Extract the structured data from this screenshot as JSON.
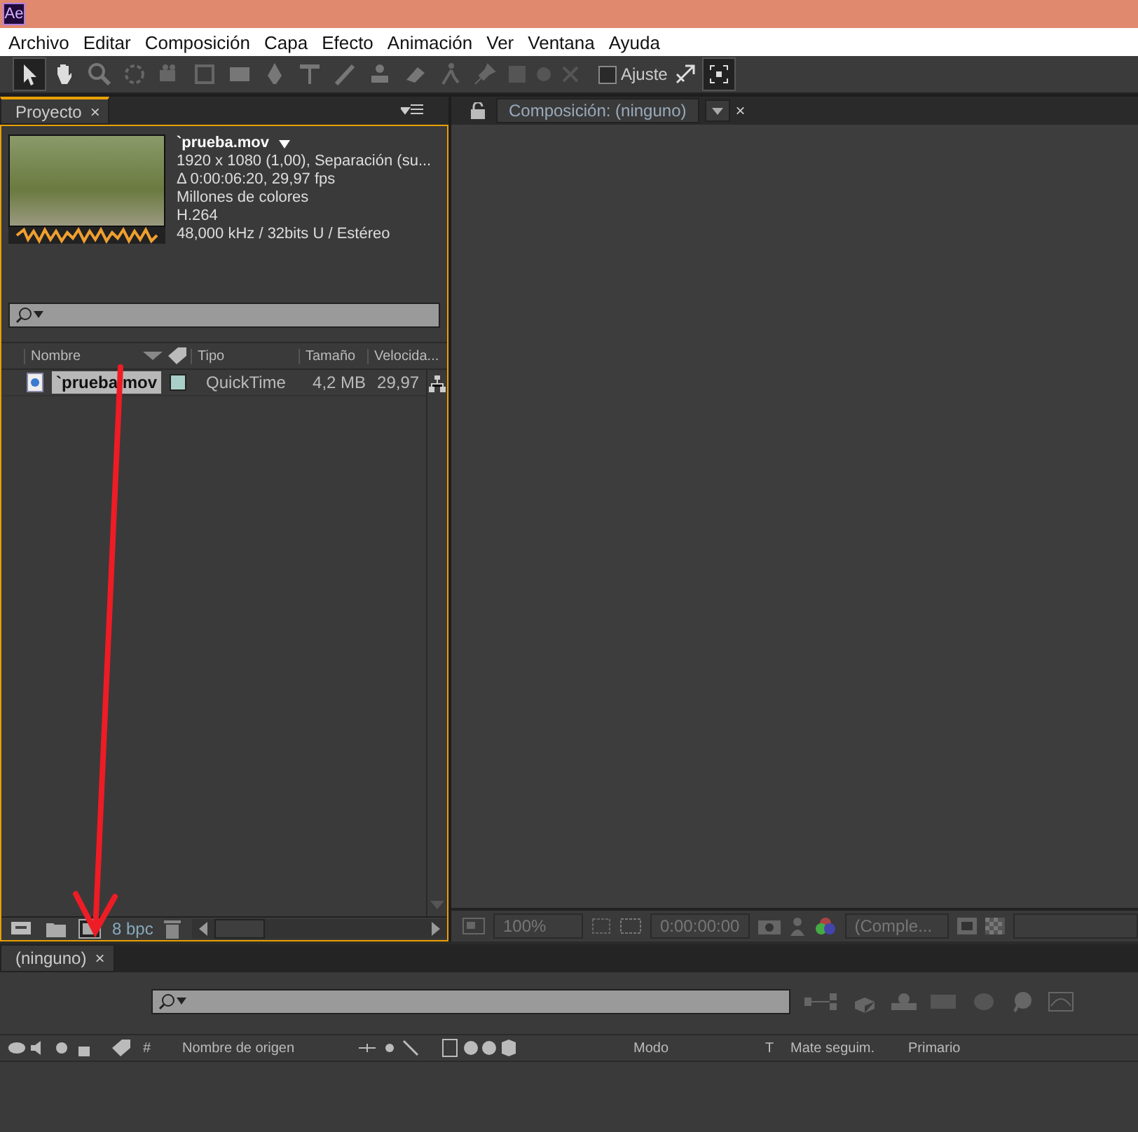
{
  "app_icon": "Ae",
  "menu": [
    "Archivo",
    "Editar",
    "Composición",
    "Capa",
    "Efecto",
    "Animación",
    "Ver",
    "Ventana",
    "Ayuda"
  ],
  "toolbar": {
    "snap": {
      "label": "Ajuste",
      "checked": false
    }
  },
  "project_panel": {
    "tab": "Proyecto",
    "close": "×",
    "preview": {
      "name": "`prueba.mov",
      "details": [
        "1920 x 1080 (1,00), Separación (su...",
        "Δ 0:00:06:20, 29,97 fps",
        "Millones de colores",
        "H.264",
        "48,000 kHz / 32bits U / Estéreo"
      ]
    },
    "columns": [
      "Nombre",
      "Tipo",
      "Tamaño",
      "Velocida..."
    ],
    "rows": [
      {
        "name": "`prueba.mov",
        "type": "QuickTime",
        "size": "4,2 MB",
        "speed": "29,97",
        "selected": true,
        "color": "#a8d0c8"
      }
    ],
    "bpc": "8 bpc"
  },
  "composition_panel": {
    "tab": "Composición: (ninguno)",
    "close": "×",
    "zoom": "100%",
    "timecode": "0:00:00:00",
    "resolution": "(Comple..."
  },
  "timeline": {
    "tab": "(ninguno)",
    "close": "×",
    "columns": [
      "#",
      "Nombre de origen",
      "Modo",
      "T",
      "Mate seguim.",
      "Primario"
    ]
  }
}
